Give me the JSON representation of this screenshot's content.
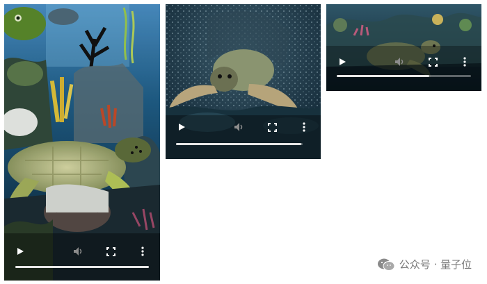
{
  "players": [
    {
      "id": "video-1",
      "progress": 1.0,
      "icons": [
        "play-icon",
        "volume-icon",
        "fullscreen-icon",
        "more-icon"
      ]
    },
    {
      "id": "video-2",
      "progress": 0.99,
      "icons": [
        "play-icon",
        "volume-icon",
        "fullscreen-icon",
        "more-icon"
      ]
    },
    {
      "id": "video-3",
      "progress": 0.69,
      "icons": [
        "play-icon",
        "volume-icon",
        "fullscreen-icon",
        "more-icon"
      ]
    }
  ],
  "watermark": {
    "text": "公众号 · 量子位",
    "icon": "wechat-icon"
  }
}
